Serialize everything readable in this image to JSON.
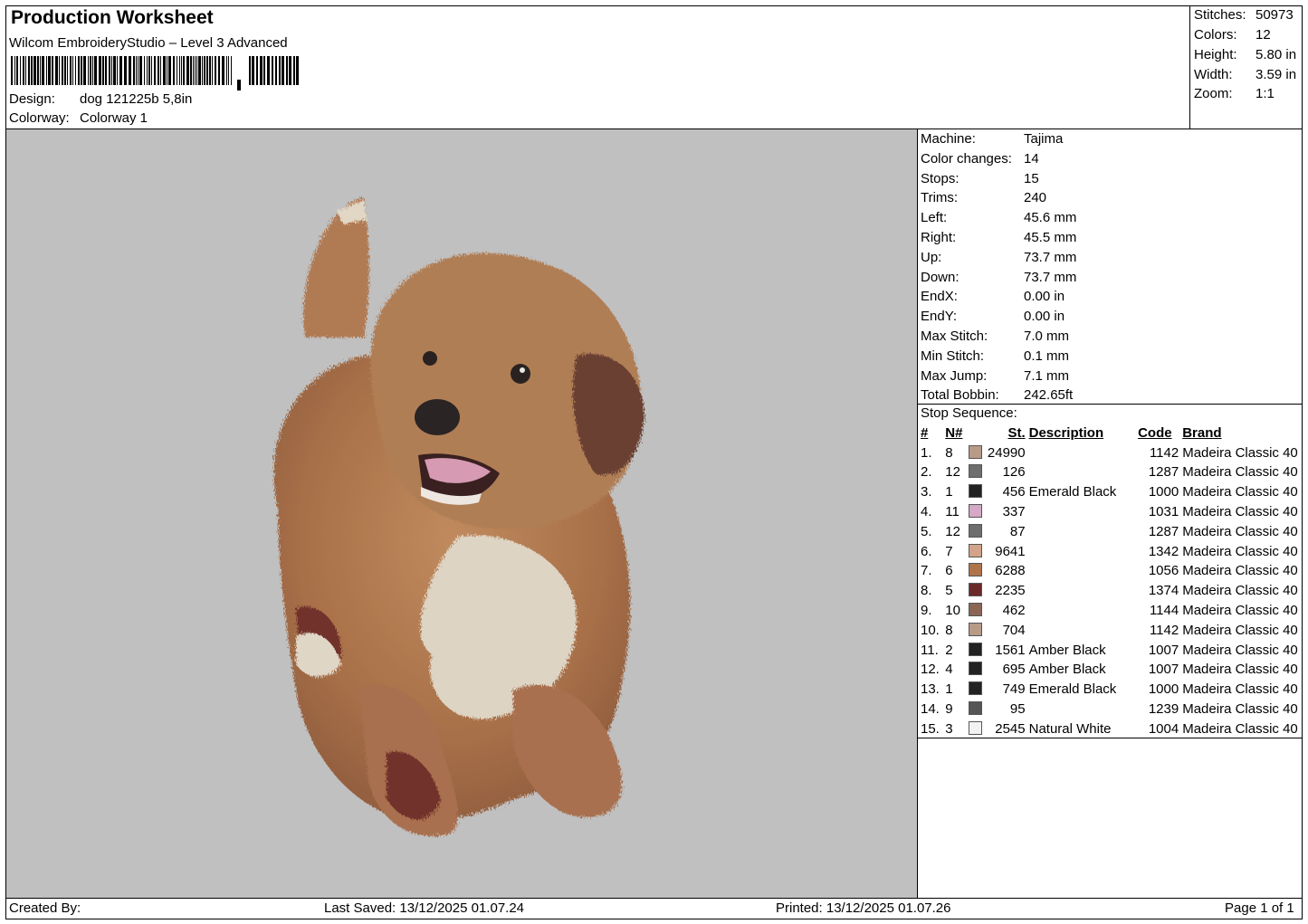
{
  "header": {
    "title": "Production Worksheet",
    "software": "Wilcom EmbroideryStudio – Level 3 Advanced",
    "design_label": "Design:",
    "design_value": "dog 121225b 5,8in",
    "colorway_label": "Colorway:",
    "colorway_value": "Colorway 1"
  },
  "summary": [
    {
      "label": "Stitches:",
      "value": "50973"
    },
    {
      "label": "Colors:",
      "value": "12"
    },
    {
      "label": "Height:",
      "value": "5.80 in"
    },
    {
      "label": "Width:",
      "value": "3.59 in"
    },
    {
      "label": "Zoom:",
      "value": "1:1"
    }
  ],
  "machine_info": [
    {
      "label": "Machine:",
      "value": "Tajima"
    },
    {
      "label": "Color changes:",
      "value": "14"
    },
    {
      "label": "Stops:",
      "value": "15"
    },
    {
      "label": "Trims:",
      "value": "240"
    },
    {
      "label": "Left:",
      "value": "45.6 mm"
    },
    {
      "label": "Right:",
      "value": "45.5 mm"
    },
    {
      "label": "Up:",
      "value": "73.7 mm"
    },
    {
      "label": "Down:",
      "value": "73.7 mm"
    },
    {
      "label": "EndX:",
      "value": "0.00 in"
    },
    {
      "label": "EndY:",
      "value": "0.00 in"
    },
    {
      "label": "Max Stitch:",
      "value": "7.0 mm"
    },
    {
      "label": "Min Stitch:",
      "value": "0.1 mm"
    },
    {
      "label": "Max Jump:",
      "value": "7.1 mm"
    },
    {
      "label": "Total Bobbin:",
      "value": "242.65ft"
    }
  ],
  "stop_sequence": {
    "title": "Stop Sequence:",
    "headers": {
      "idx": "#",
      "n": "N#",
      "st": "St.",
      "desc": "Description",
      "code": "Code",
      "brand": "Brand"
    },
    "rows": [
      {
        "idx": "1.",
        "n": "8",
        "color": "#b89a88",
        "st": "24990",
        "desc": "",
        "code": "1142",
        "brand": "Madeira Classic 40"
      },
      {
        "idx": "2.",
        "n": "12",
        "color": "#6e6e6e",
        "st": "126",
        "desc": "",
        "code": "1287",
        "brand": "Madeira Classic 40"
      },
      {
        "idx": "3.",
        "n": "1",
        "color": "#222222",
        "st": "456",
        "desc": "Emerald Black",
        "code": "1000",
        "brand": "Madeira Classic 40"
      },
      {
        "idx": "4.",
        "n": "11",
        "color": "#d4a8c6",
        "st": "337",
        "desc": "",
        "code": "1031",
        "brand": "Madeira Classic 40"
      },
      {
        "idx": "5.",
        "n": "12",
        "color": "#6e6e6e",
        "st": "87",
        "desc": "",
        "code": "1287",
        "brand": "Madeira Classic 40"
      },
      {
        "idx": "6.",
        "n": "7",
        "color": "#d2a28a",
        "st": "9641",
        "desc": "",
        "code": "1342",
        "brand": "Madeira Classic 40"
      },
      {
        "idx": "7.",
        "n": "6",
        "color": "#b0744a",
        "st": "6288",
        "desc": "",
        "code": "1056",
        "brand": "Madeira Classic 40"
      },
      {
        "idx": "8.",
        "n": "5",
        "color": "#6a2a2a",
        "st": "2235",
        "desc": "",
        "code": "1374",
        "brand": "Madeira Classic 40"
      },
      {
        "idx": "9.",
        "n": "10",
        "color": "#8a6656",
        "st": "462",
        "desc": "",
        "code": "1144",
        "brand": "Madeira Classic 40"
      },
      {
        "idx": "10.",
        "n": "8",
        "color": "#b89a88",
        "st": "704",
        "desc": "",
        "code": "1142",
        "brand": "Madeira Classic 40"
      },
      {
        "idx": "11.",
        "n": "2",
        "color": "#222222",
        "st": "1561",
        "desc": "Amber Black",
        "code": "1007",
        "brand": "Madeira Classic 40"
      },
      {
        "idx": "12.",
        "n": "4",
        "color": "#222222",
        "st": "695",
        "desc": "Amber Black",
        "code": "1007",
        "brand": "Madeira Classic 40"
      },
      {
        "idx": "13.",
        "n": "1",
        "color": "#222222",
        "st": "749",
        "desc": "Emerald Black",
        "code": "1000",
        "brand": "Madeira Classic 40"
      },
      {
        "idx": "14.",
        "n": "9",
        "color": "#555555",
        "st": "95",
        "desc": "",
        "code": "1239",
        "brand": "Madeira Classic 40"
      },
      {
        "idx": "15.",
        "n": "3",
        "color": "#f2f2f2",
        "st": "2545",
        "desc": "Natural White",
        "code": "1004",
        "brand": "Madeira Classic 40"
      }
    ]
  },
  "footer": {
    "created_by": "Created By:",
    "last_saved": "Last Saved: 13/12/2025 01.07.24",
    "printed": "Printed: 13/12/2025 01.07.26",
    "page": "Page 1 of 1"
  }
}
